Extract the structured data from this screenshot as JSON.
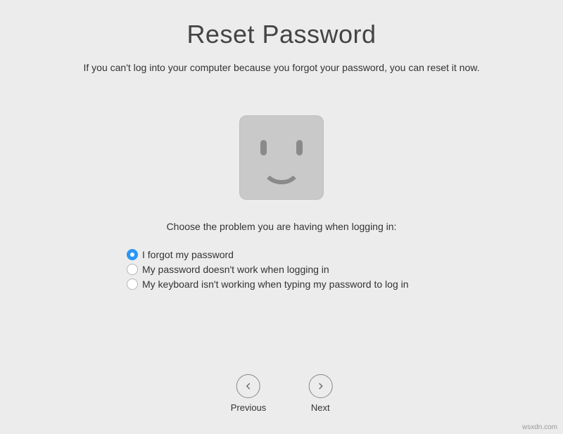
{
  "title": "Reset Password",
  "subtitle": "If you can't log into your computer because you forgot your password, you can reset it now.",
  "prompt": "Choose the problem you are having when logging in:",
  "options": [
    {
      "label": "I forgot my password",
      "selected": true
    },
    {
      "label": "My password doesn't work when logging in",
      "selected": false
    },
    {
      "label": "My keyboard isn't working when typing my password to log in",
      "selected": false
    }
  ],
  "nav": {
    "previous": "Previous",
    "next": "Next"
  },
  "watermark": "wsxdn.com"
}
